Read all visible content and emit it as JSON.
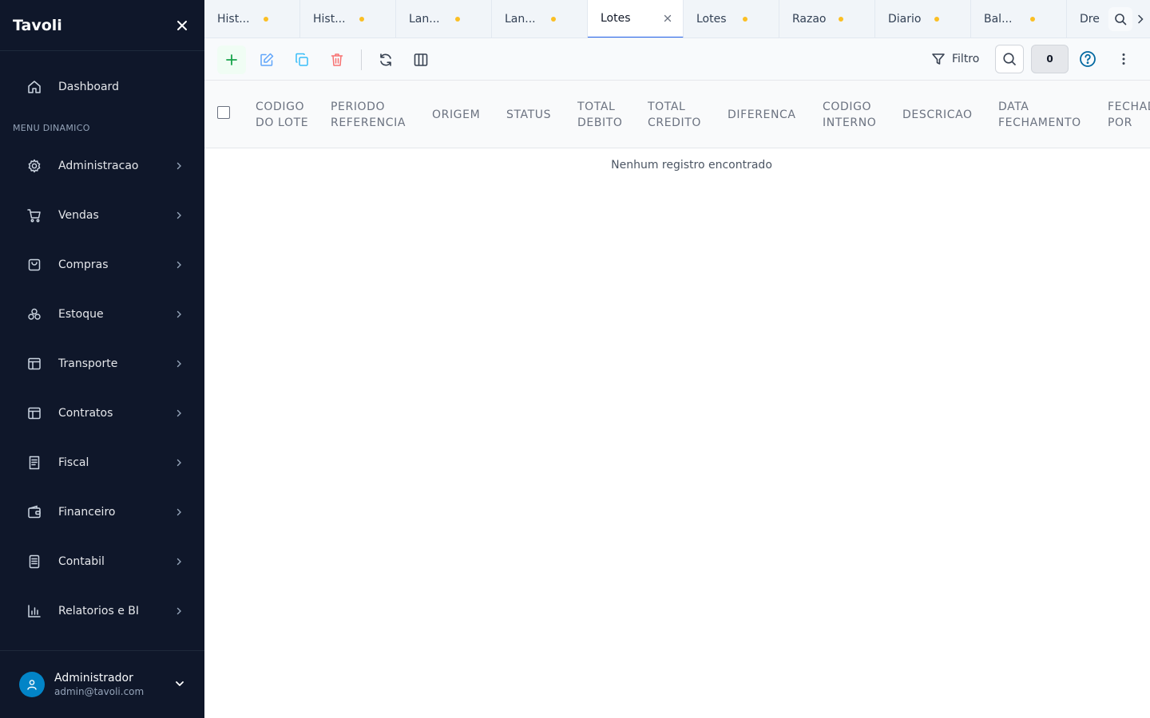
{
  "app": {
    "title": "Tavoli"
  },
  "sidebar": {
    "dashboard_label": "Dashboard",
    "section_label": "MENU DINAMICO",
    "items": [
      {
        "label": "Administracao",
        "icon": "gear-icon"
      },
      {
        "label": "Vendas",
        "icon": "cart-icon"
      },
      {
        "label": "Compras",
        "icon": "shopping-bag-icon"
      },
      {
        "label": "Estoque",
        "icon": "boxes-icon"
      },
      {
        "label": "Transporte",
        "icon": "layout-icon"
      },
      {
        "label": "Contratos",
        "icon": "layout-icon"
      },
      {
        "label": "Fiscal",
        "icon": "receipt-icon"
      },
      {
        "label": "Financeiro",
        "icon": "wallet-icon"
      },
      {
        "label": "Contabil",
        "icon": "document-icon"
      },
      {
        "label": "Relatorios e BI",
        "icon": "bar-chart-icon"
      }
    ],
    "user": {
      "name": "Administrador",
      "email": "admin@tavoli.com"
    }
  },
  "tabs": [
    {
      "label": "Hist..."
    },
    {
      "label": "Hist..."
    },
    {
      "label": "Lan..."
    },
    {
      "label": "Lan..."
    },
    {
      "label": "Lotes",
      "active": true
    },
    {
      "label": "Lotes"
    },
    {
      "label": "Razao"
    },
    {
      "label": "Diario"
    },
    {
      "label": "Bal..."
    },
    {
      "label": "Dre"
    }
  ],
  "toolbar": {
    "filter_label": "Filtro",
    "count": "0"
  },
  "table": {
    "columns": [
      "CODIGO DO LOTE",
      "PERIODO REFERENCIA",
      "ORIGEM",
      "STATUS",
      "TOTAL DEBITO",
      "TOTAL CREDITO",
      "DIFERENCA",
      "CODIGO INTERNO",
      "DESCRICAO",
      "DATA FECHAMENTO",
      "FECHADO POR"
    ],
    "empty_message": "Nenhum registro encontrado"
  },
  "colors": {
    "sidebar_bg": "#0f172a",
    "accent": "#2563eb",
    "tab_dot": "#fbbf24",
    "add": "#16a34a",
    "edit": "#60a5fa",
    "copy": "#38bdf8",
    "delete": "#f87171",
    "help": "#0369a1",
    "avatar": "#0284c7"
  }
}
